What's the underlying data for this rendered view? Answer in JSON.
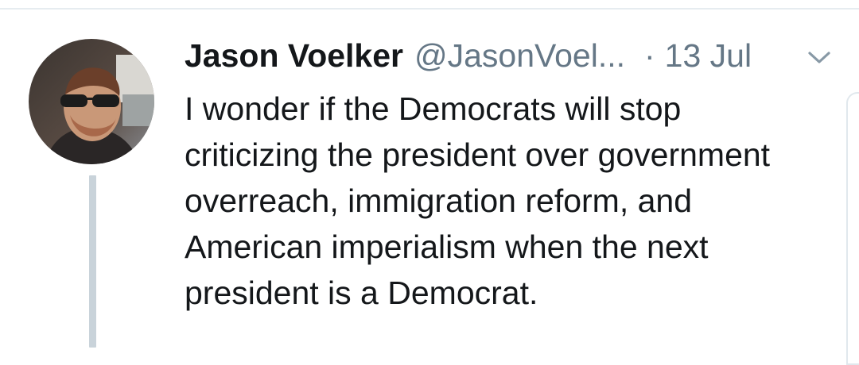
{
  "tweet": {
    "author_name": "Jason Voelker",
    "author_handle": "@JasonVoel...",
    "separator": "·",
    "timestamp": "13 Jul",
    "text_lines": [
      "I wonder if the Democrats will stop",
      "criticizing the president over government",
      "overreach, immigration reform, and",
      "American imperialism when the next",
      "president is a Democrat."
    ]
  },
  "icons": {
    "menu_caret": "chevron-down-icon"
  },
  "colors": {
    "text_primary": "#14171a",
    "text_secondary": "#657786",
    "thread_line": "#c9d3da",
    "divider": "#e6ecf0"
  }
}
